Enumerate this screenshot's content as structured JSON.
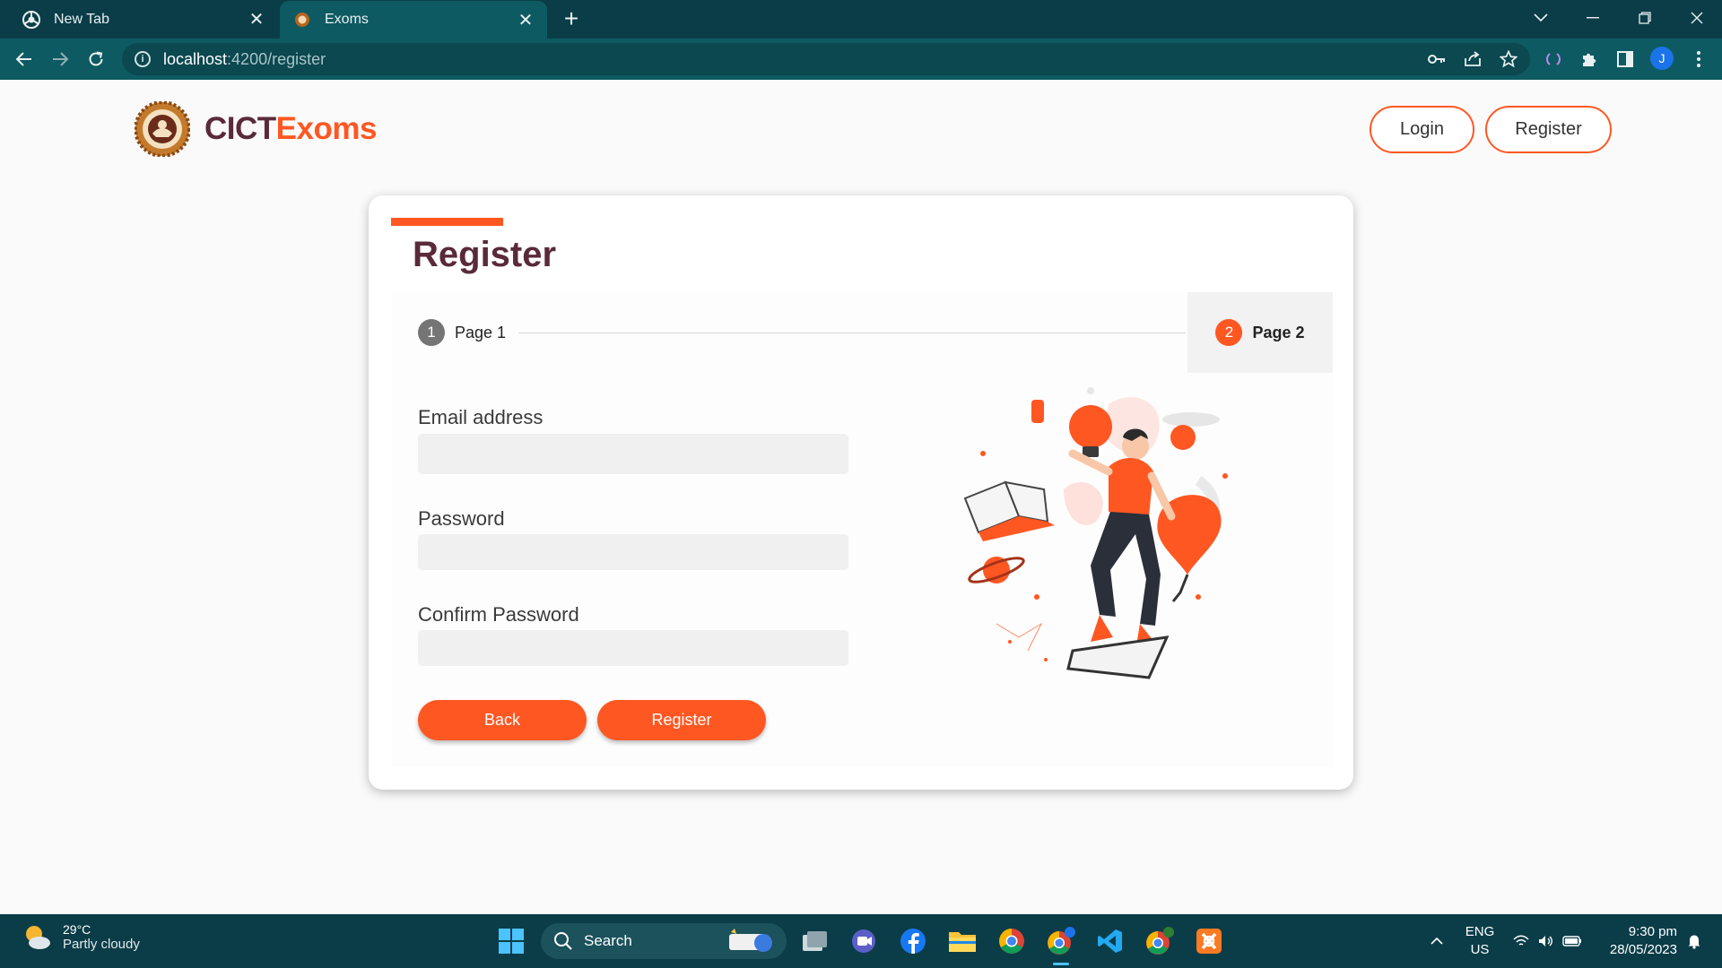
{
  "browser": {
    "tabs": [
      {
        "title": "New Tab",
        "active": false,
        "icon": "chrome-icon"
      },
      {
        "title": "Exoms",
        "active": true,
        "icon": "site-favicon-icon"
      }
    ],
    "url_host": "localhost",
    "url_path": ":4200/register",
    "avatar_letter": "J"
  },
  "header": {
    "brand_part1": "CICT",
    "brand_part2": "Exoms",
    "login_label": "Login",
    "register_label": "Register"
  },
  "card": {
    "title": "Register",
    "steps": [
      {
        "number": "1",
        "label": "Page 1",
        "active": false
      },
      {
        "number": "2",
        "label": "Page 2",
        "active": true
      }
    ],
    "fields": [
      {
        "label": "Email address",
        "value": ""
      },
      {
        "label": "Password",
        "value": ""
      },
      {
        "label": "Confirm Password",
        "value": ""
      }
    ],
    "back_label": "Back",
    "register_label": "Register"
  },
  "taskbar": {
    "temperature": "29°C",
    "weather": "Partly cloudy",
    "search_label": "Search",
    "lang_line1": "ENG",
    "lang_line2": "US",
    "time": "9:30 pm",
    "date": "28/05/2023"
  },
  "colors": {
    "accent": "#ff5722",
    "brand_dark": "#5a2a3a",
    "chrome_dark": "#0b3d48",
    "chrome_toolbar": "#0e5a62"
  }
}
